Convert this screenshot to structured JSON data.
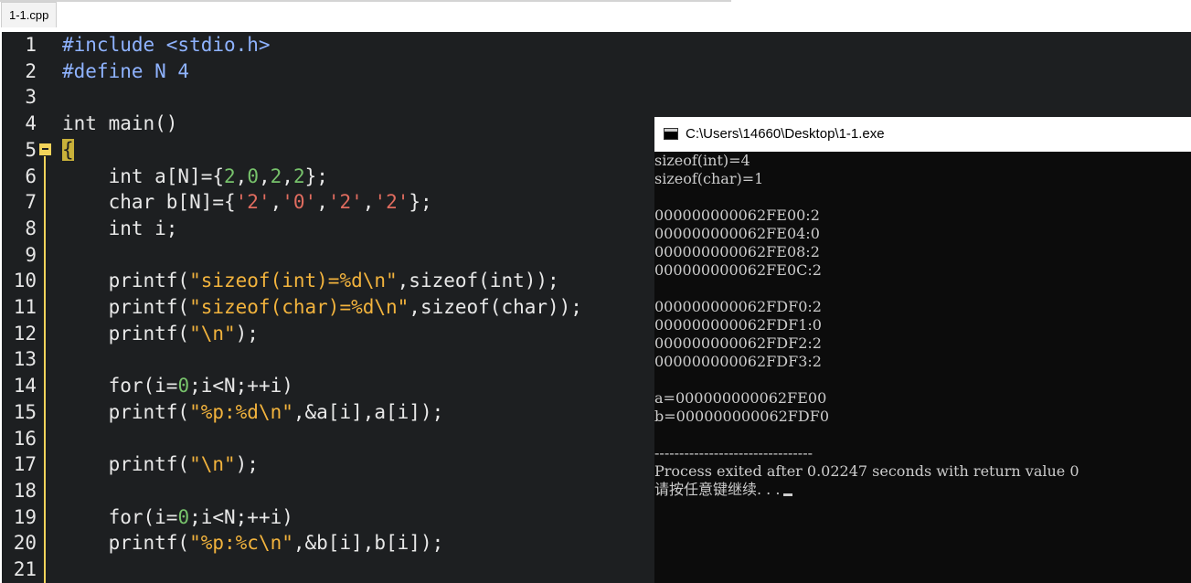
{
  "tab": {
    "label": "1-1.cpp"
  },
  "editor": {
    "line_numbers": [
      "1",
      "2",
      "3",
      "4",
      "5",
      "6",
      "7",
      "8",
      "9",
      "10",
      "11",
      "12",
      "13",
      "14",
      "15",
      "16",
      "17",
      "18",
      "19",
      "20",
      "21"
    ],
    "lines": [
      "#include <stdio.h>",
      "#define N 4",
      "",
      "int main()",
      "{",
      "    int a[N]={2,0,2,2};",
      "    char b[N]={'2','0','2','2'};",
      "    int i;",
      "",
      "    printf(\"sizeof(int)=%d\\n\",sizeof(int));",
      "    printf(\"sizeof(char)=%d\\n\",sizeof(char));",
      "    printf(\"\\n\");",
      "",
      "    for(i=0;i<N;++i)",
      "    printf(\"%p:%d\\n\",&a[i],a[i]);",
      "",
      "    printf(\"\\n\");",
      "",
      "    for(i=0;i<N;++i)",
      "    printf(\"%p:%c\\n\",&b[i],b[i]);",
      ""
    ]
  },
  "console": {
    "title": "C:\\Users\\14660\\Desktop\\1-1.exe",
    "lines": [
      "sizeof(int)=4",
      "sizeof(char)=1",
      "",
      "000000000062FE00:2",
      "000000000062FE04:0",
      "000000000062FE08:2",
      "000000000062FE0C:2",
      "",
      "000000000062FDF0:2",
      "000000000062FDF1:0",
      "000000000062FDF2:2",
      "000000000062FDF3:2",
      "",
      "a=000000000062FE00",
      "b=000000000062FDF0",
      "",
      "--------------------------------",
      "Process exited after 0.02247 seconds with return value 0",
      "请按任意键继续. . ."
    ]
  },
  "colors": {
    "editor_bg": "#1d1f21",
    "console_bg": "#0c0c0c",
    "string": "#f2b33d",
    "number": "#77c26b",
    "preprocessor": "#8fb3ff",
    "char_literal": "#e06c5f",
    "fold_marker": "#f2d35a"
  }
}
